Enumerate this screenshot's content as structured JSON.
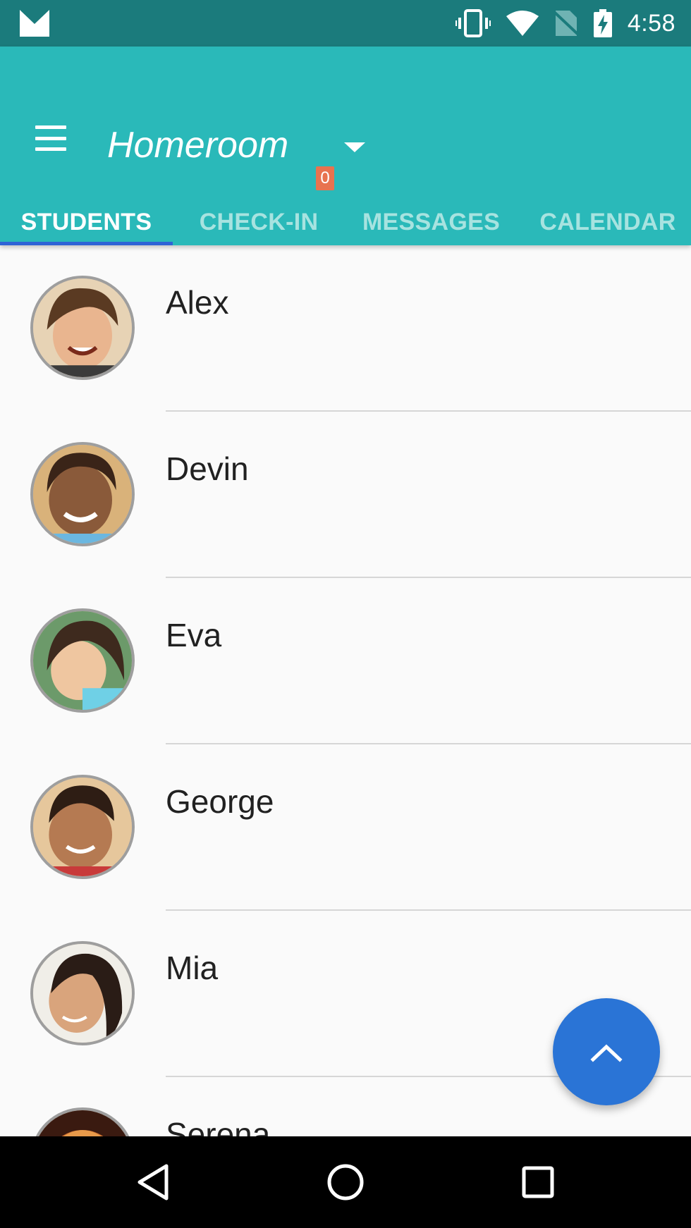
{
  "status_bar": {
    "time": "4:58",
    "icons": [
      "gmail-notification-icon",
      "vibrate-icon",
      "wifi-icon",
      "no-sim-icon",
      "battery-charging-icon"
    ]
  },
  "app_bar": {
    "title": "Homeroom",
    "menu_icon": "menu-icon",
    "dropdown_icon": "arrow-drop-down-icon",
    "tabs": [
      {
        "label": "STUDENTS",
        "active": true
      },
      {
        "label": "CHECK-IN",
        "active": false,
        "badge": "0"
      },
      {
        "label": "MESSAGES",
        "active": false
      },
      {
        "label": "CALENDAR",
        "active": false
      }
    ]
  },
  "students": [
    {
      "name": "Alex"
    },
    {
      "name": "Devin"
    },
    {
      "name": "Eva"
    },
    {
      "name": "George"
    },
    {
      "name": "Mia"
    },
    {
      "name": "Serena"
    }
  ],
  "fab": {
    "icon": "chevron-up-icon"
  },
  "nav_bar": {
    "icons": [
      "back-icon",
      "home-icon",
      "recents-icon"
    ]
  },
  "colors": {
    "status_bar": "#1b7b7c",
    "app_bar": "#2ab9b9",
    "tab_indicator": "#2f64d6",
    "badge": "#e8734f",
    "fab": "#2a74d6"
  }
}
